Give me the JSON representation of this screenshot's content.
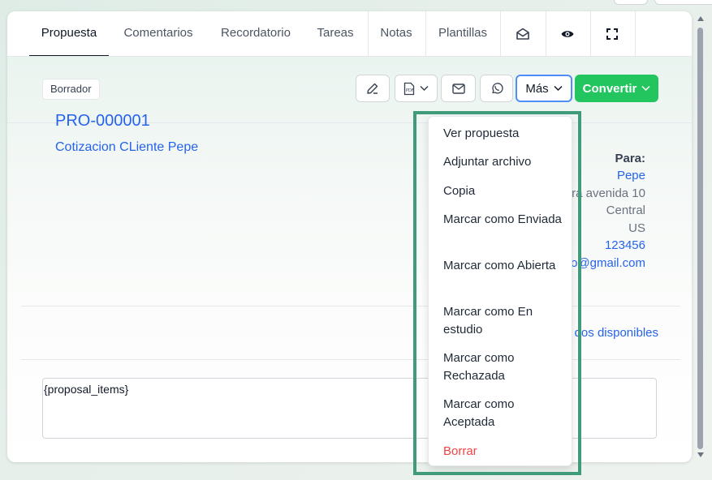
{
  "tabs": [
    {
      "label": "Propuesta",
      "active": true
    },
    {
      "label": "Comentarios"
    },
    {
      "label": "Recordatorio"
    },
    {
      "label": "Tareas"
    },
    {
      "label": "Notas"
    },
    {
      "label": "Plantillas"
    }
  ],
  "tab_icons": [
    "envelope-open-icon",
    "eye-icon",
    "fullscreen-icon"
  ],
  "status_badge": "Borrador",
  "toolbar": {
    "icons": [
      "edit-icon",
      "pdf-icon",
      "mail-icon",
      "whatsapp-icon"
    ],
    "more_label": "Más",
    "convert_label": "Convertir"
  },
  "proposal": {
    "number": "PRO-000001",
    "subject": "Cotizacion CLiente Pepe"
  },
  "recipient": {
    "to_label": "Para:",
    "name": "Pepe",
    "address": "ra avenida 10",
    "city": "Central",
    "country": "US",
    "phone": "123456",
    "email": "o@gmail.com"
  },
  "available_link": "dos disponibles",
  "items_placeholder": "{proposal_items}",
  "dropdown": {
    "items": [
      {
        "label": "Ver propuesta"
      },
      {
        "label": "Adjuntar archivo"
      },
      {
        "label": "Copia"
      },
      {
        "label": "Marcar como Enviada"
      },
      {
        "label": "Marcar como Abierta"
      },
      {
        "label": "Marcar como En estudio"
      },
      {
        "label": "Marcar como Rechazada"
      },
      {
        "label": "Marcar como Aceptada"
      },
      {
        "label": "Borrar",
        "danger": true
      }
    ]
  },
  "colors": {
    "accent_blue": "#2563eb",
    "convert_green": "#22c55e",
    "danger_red": "#ef4444",
    "highlight_green": "#3f9b7a"
  }
}
